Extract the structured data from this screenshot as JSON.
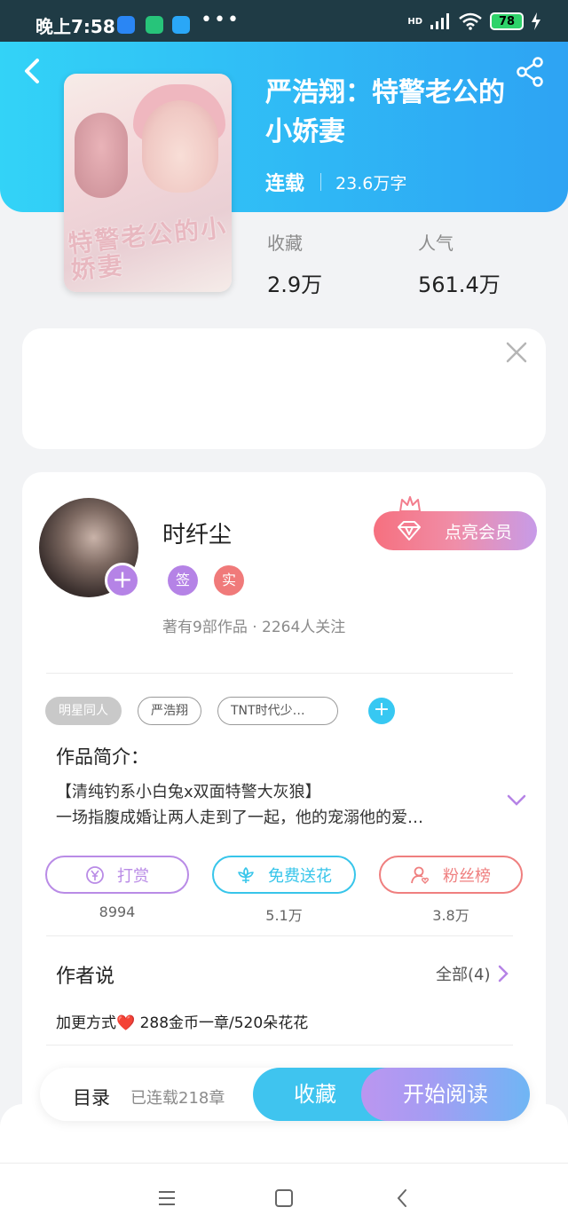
{
  "status_bar": {
    "time": "晚上7:58",
    "dots": "•••",
    "network": "HD",
    "battery": "78"
  },
  "book": {
    "title": "严浩翔：特警老公的小娇妻",
    "status": "连载",
    "word_count": "23.6万字",
    "cover_title": "特警老公的小娇妻",
    "stats": [
      {
        "label": "收藏",
        "value": "2.9万"
      },
      {
        "label": "人气",
        "value": "561.4万"
      }
    ]
  },
  "author": {
    "name": "时纤尘",
    "badges": [
      "签",
      "实"
    ],
    "stats": "著有9部作品 · 2264人关注",
    "vip_label": "点亮会员"
  },
  "tags": [
    "明星同人",
    "严浩翔",
    "TNT时代少…"
  ],
  "intro": {
    "title": "作品简介：",
    "line1": "【清纯钓系小白兔x双面特警大灰狼】",
    "line2": "一场指腹成婚让两人走到了一起，他的宠溺他的爱…"
  },
  "actions": [
    {
      "label": "打赏",
      "count": "8994",
      "icon": "coin-yen-icon",
      "color": "#b98be6"
    },
    {
      "label": "免费送花",
      "count": "5.1万",
      "icon": "flower-icon",
      "color": "#37c5ea"
    },
    {
      "label": "粉丝榜",
      "count": "3.8万",
      "icon": "fan-user-icon",
      "color": "#ef7f7f"
    }
  ],
  "author_says": {
    "title": "作者说",
    "all_label": "全部(4)",
    "note": "加更方式❤️ 288金币一章/520朵花花"
  },
  "bottom_bar": {
    "toc_label": "目录",
    "chapters": "已连载218章",
    "collect_label": "收藏",
    "read_label": "开始阅读"
  },
  "colors": {
    "header_start": "#33d3f7",
    "header_end": "#2ea3f3",
    "accent_purple": "#b583e6",
    "accent_blue": "#3fc4ef"
  }
}
